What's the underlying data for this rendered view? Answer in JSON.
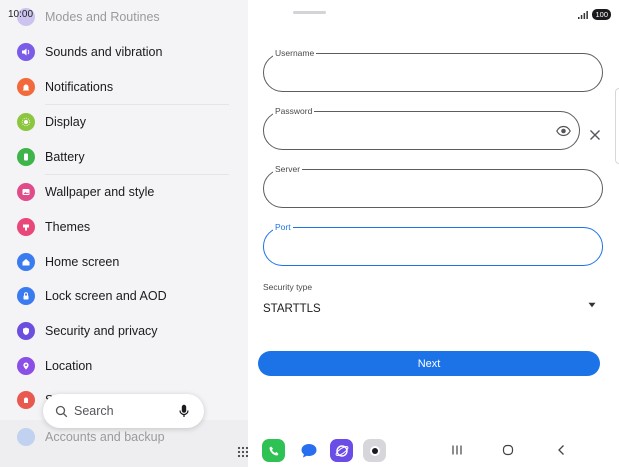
{
  "status_bar": {
    "time": "10:00",
    "battery": "100"
  },
  "settings": {
    "items": [
      {
        "label": "Modes and Routines",
        "icon": "modes-icon",
        "color": "#9c8ae6",
        "faded": true
      },
      {
        "label": "Sounds and vibration",
        "icon": "speaker-icon",
        "color": "#7a5ce8"
      },
      {
        "label": "Notifications",
        "icon": "bell-icon",
        "color": "#f26a3b"
      },
      {
        "label": "Display",
        "icon": "sun-icon",
        "color": "#8cc63f"
      },
      {
        "label": "Battery",
        "icon": "battery-icon",
        "color": "#3fb44a"
      },
      {
        "label": "Wallpaper and style",
        "icon": "image-icon",
        "color": "#e04b8a"
      },
      {
        "label": "Themes",
        "icon": "theme-icon",
        "color": "#e9477a"
      },
      {
        "label": "Home screen",
        "icon": "home-icon",
        "color": "#3a7bf0"
      },
      {
        "label": "Lock screen and AOD",
        "icon": "lock-icon",
        "color": "#3a7bf0"
      },
      {
        "label": "Security and privacy",
        "icon": "shield-icon",
        "color": "#6d4fe0"
      },
      {
        "label": "Location",
        "icon": "location-pin-icon",
        "color": "#8b4ee6"
      },
      {
        "label": "S",
        "icon": "safety-icon",
        "color": "#e85a4f"
      },
      {
        "label": "Accounts and backup",
        "icon": "accounts-icon",
        "color": "#8aaef0",
        "faded": true
      }
    ],
    "search_label": "Search"
  },
  "form": {
    "username_label": "Username",
    "password_label": "Password",
    "server_label": "Server",
    "port_label": "Port",
    "security_type_label": "Security type",
    "security_type_value": "STARTTLS",
    "next_label": "Next"
  },
  "colors": {
    "accent": "#1c73e8"
  },
  "dock": {
    "apps": [
      "phone-app-icon",
      "messages-app-icon",
      "internet-app-icon",
      "camera-app-icon"
    ]
  }
}
